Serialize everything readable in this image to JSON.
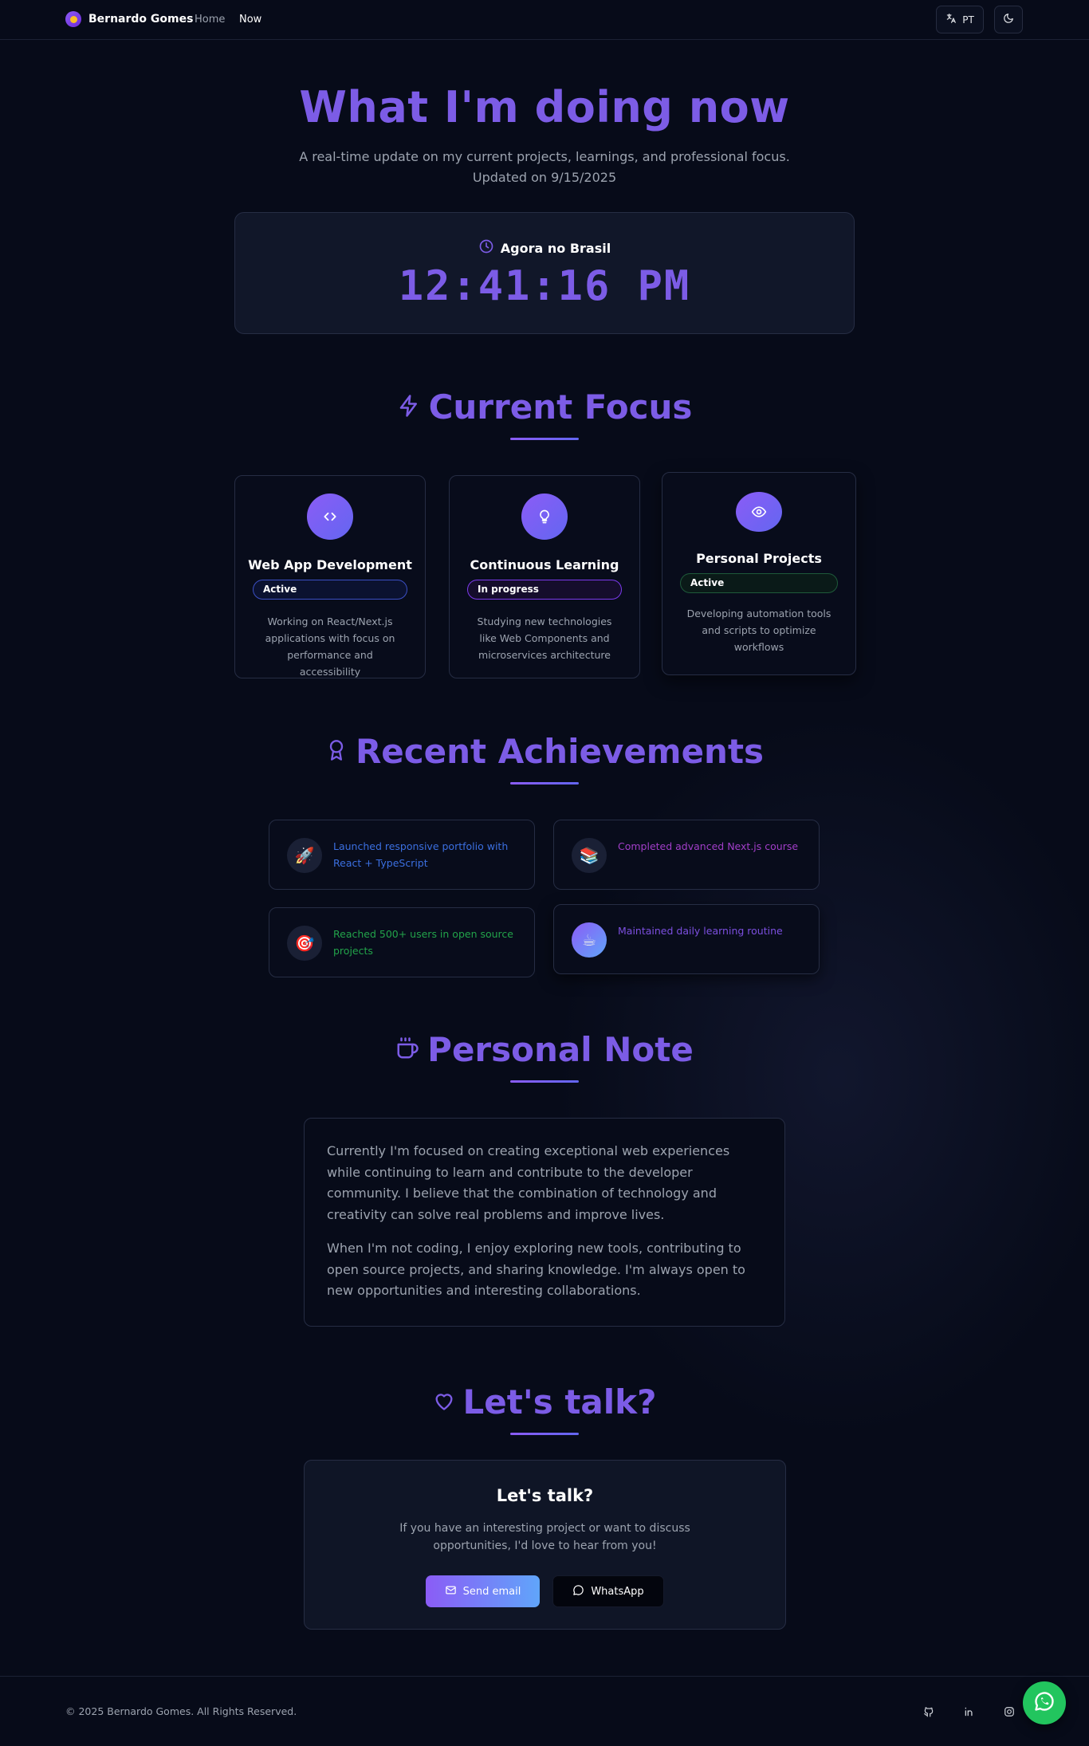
{
  "nav": {
    "brand": "Bernardo Gomes",
    "links": [
      {
        "label": "Home"
      },
      {
        "label": "Now"
      }
    ],
    "lang_label": "PT"
  },
  "hero": {
    "title": "What I'm doing now",
    "subtitle": "A real-time update on my current projects, learnings, and professional focus.",
    "updated": "Updated on 9/15/2025"
  },
  "clock": {
    "label": "Agora no Brasil",
    "time": "12:41:16 PM"
  },
  "focus": {
    "heading": "Current Focus",
    "cards": [
      {
        "title": "Web App Development",
        "badge": "Active",
        "desc": "Working on React/Next.js applications with focus on performance and accessibility",
        "icon": "code-icon"
      },
      {
        "title": "Continuous Learning",
        "badge": "In progress",
        "desc": "Studying new technologies like Web Components and microservices architecture",
        "icon": "lightbulb-icon"
      },
      {
        "title": "Personal Projects",
        "badge": "Active",
        "desc": "Developing automation tools and scripts to optimize workflows",
        "icon": "eye-icon"
      }
    ]
  },
  "achievements": {
    "heading": "Recent Achievements",
    "items": [
      {
        "text": "Launched responsive portfolio with React + TypeScript",
        "emoji": "🚀",
        "color": "#3b6fe0"
      },
      {
        "text": "Completed advanced Next.js course",
        "emoji": "📚",
        "color": "#a23ec9"
      },
      {
        "text": "Reached 500+ users in open source projects",
        "emoji": "🎯",
        "color": "#22a34a"
      },
      {
        "text": "Maintained daily learning routine",
        "emoji": "☕",
        "color": "#7c4fe0"
      }
    ]
  },
  "note": {
    "heading": "Personal Note",
    "paragraphs": [
      "Currently I'm focused on creating exceptional web experiences while continuing to learn and contribute to the developer community. I believe that the combination of technology and creativity can solve real problems and improve lives.",
      "When I'm not coding, I enjoy exploring new tools, contributing to open source projects, and sharing knowledge. I'm always open to new opportunities and interesting collaborations."
    ]
  },
  "contact": {
    "heading": "Let's talk?",
    "title": "Let's talk?",
    "desc": "If you have an interesting project or want to discuss opportunities, I'd love to hear from you!",
    "email_label": "Send email",
    "whatsapp_label": "WhatsApp"
  },
  "footer": {
    "copyright": "© 2025 Bernardo Gomes. All Rights Reserved."
  },
  "colors": {
    "accent": "#7c5ce6",
    "background": "#070b19",
    "whatsapp": "#22c55e"
  }
}
